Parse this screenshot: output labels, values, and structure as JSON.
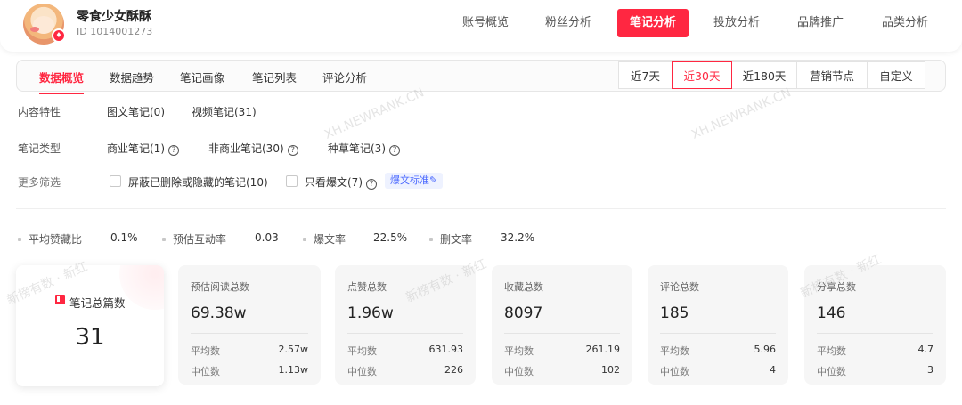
{
  "account": {
    "name": "零食少女酥酥",
    "id_text": "ID 1014001273"
  },
  "top_nav": [
    {
      "label": "账号概览"
    },
    {
      "label": "粉丝分析"
    },
    {
      "label": "笔记分析"
    },
    {
      "label": "投放分析"
    },
    {
      "label": "品牌推广"
    },
    {
      "label": "品类分析"
    }
  ],
  "sub_tabs": [
    {
      "label": "数据概览"
    },
    {
      "label": "数据趋势"
    },
    {
      "label": "笔记画像"
    },
    {
      "label": "笔记列表"
    },
    {
      "label": "评论分析"
    }
  ],
  "ranges": [
    {
      "label": "近7天"
    },
    {
      "label": "近30天"
    },
    {
      "label": "近180天"
    },
    {
      "label": "营销节点"
    },
    {
      "label": "自定义"
    }
  ],
  "filters": {
    "content": {
      "label": "内容特性",
      "options": [
        "图文笔记(0)",
        "视频笔记(31)"
      ]
    },
    "type": {
      "label": "笔记类型",
      "options": [
        "商业笔记(1)",
        "非商业笔记(30)",
        "种草笔记(3)"
      ]
    },
    "more": {
      "label": "更多筛选",
      "options": [
        "屏蔽已删除或隐藏的笔记(10)",
        "只看爆文(7)"
      ],
      "tag": "爆文标准✎"
    }
  },
  "summary": [
    {
      "label": "平均赞藏比",
      "value": "0.1%"
    },
    {
      "label": "预估互动率",
      "value": "0.03"
    },
    {
      "label": "爆文率",
      "value": "22.5%"
    },
    {
      "label": "删文率",
      "value": "32.2%"
    }
  ],
  "total_card": {
    "label": "笔记总篇数",
    "value": "31"
  },
  "stat_cards": [
    {
      "title": "预估阅读总数",
      "value": "69.38w",
      "avg_label": "平均数",
      "avg": "2.57w",
      "med_label": "中位数",
      "med": "1.13w"
    },
    {
      "title": "点赞总数",
      "value": "1.96w",
      "avg_label": "平均数",
      "avg": "631.93",
      "med_label": "中位数",
      "med": "226"
    },
    {
      "title": "收藏总数",
      "value": "8097",
      "avg_label": "平均数",
      "avg": "261.19",
      "med_label": "中位数",
      "med": "102"
    },
    {
      "title": "评论总数",
      "value": "185",
      "avg_label": "平均数",
      "avg": "5.96",
      "med_label": "中位数",
      "med": "4"
    },
    {
      "title": "分享总数",
      "value": "146",
      "avg_label": "平均数",
      "avg": "4.7",
      "med_label": "中位数",
      "med": "3"
    }
  ],
  "watermarks": {
    "site": "XH.NEWRANK.CN",
    "brand": "新榜有数 · 新红"
  },
  "colors": {
    "accent": "#ff2741",
    "tag": "#4b69ff"
  }
}
